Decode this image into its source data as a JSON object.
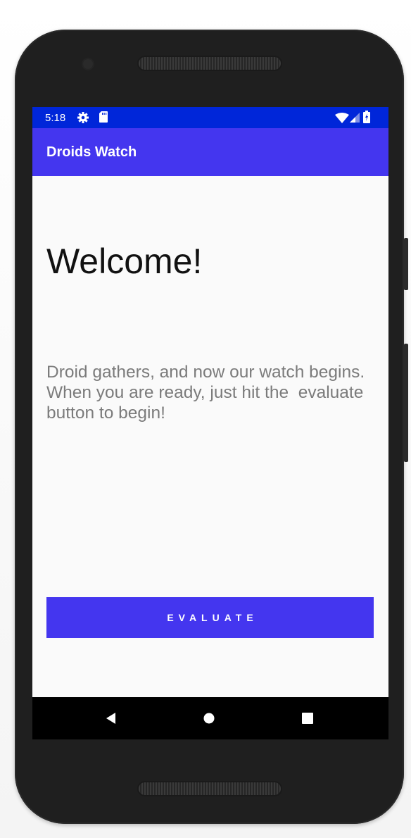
{
  "status_bar": {
    "time": "5:18",
    "background": "#0026d9",
    "icons_left": [
      "settings-icon",
      "sd-card-icon"
    ],
    "icons_right": [
      "wifi-icon",
      "cell-signal-icon",
      "battery-icon"
    ]
  },
  "app_bar": {
    "title": "Droids Watch",
    "background": "#4436ef"
  },
  "main": {
    "heading": "Welcome!",
    "intro_text": "Droid gathers, and now our watch begins. When you are ready, just hit the  evaluate button to begin!",
    "evaluate_button_label": "EVALUATE",
    "button_color": "#4436ef"
  },
  "nav_bar": {
    "items": [
      "back-icon",
      "home-icon",
      "recents-icon"
    ]
  }
}
